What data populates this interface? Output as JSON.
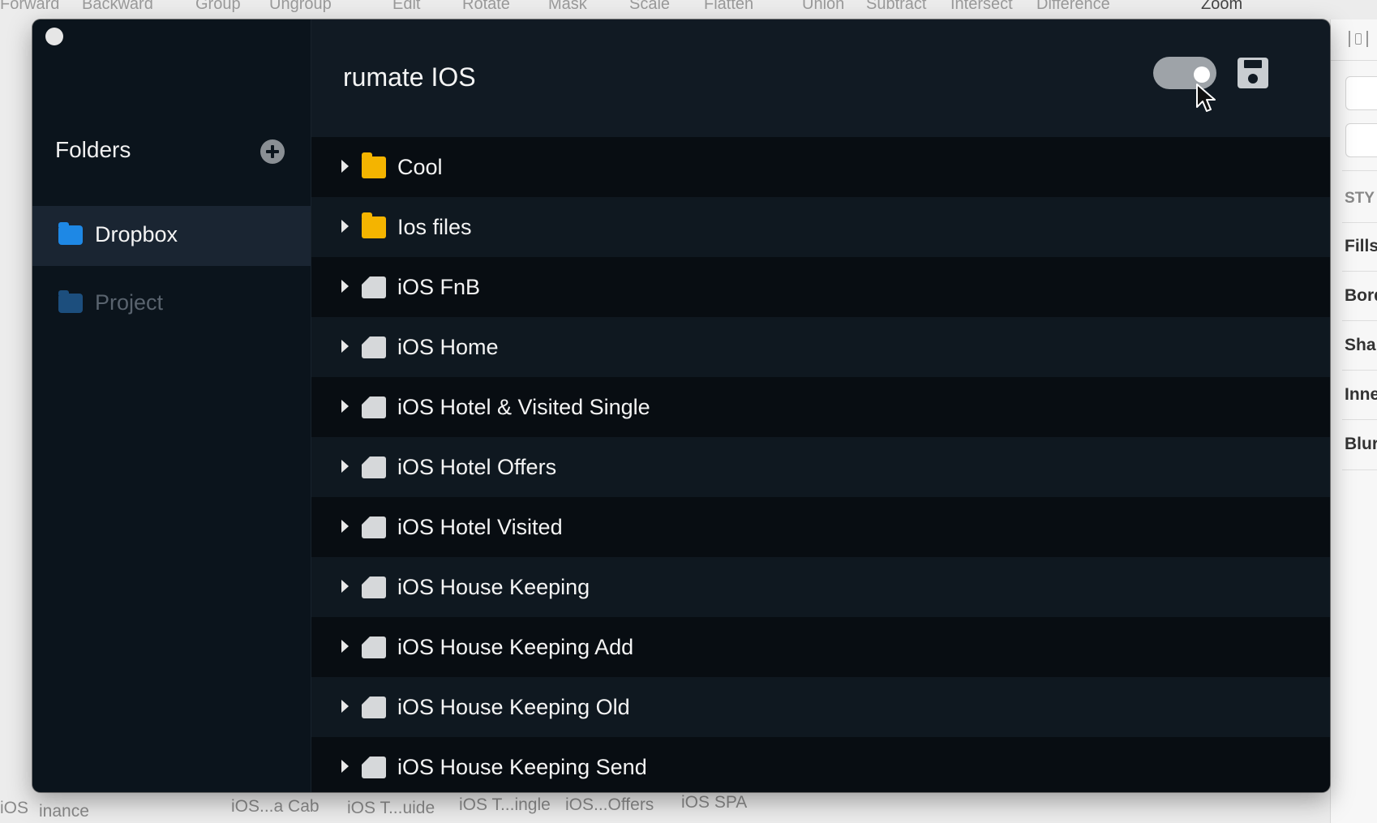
{
  "bg_toolbar": {
    "items": [
      "Forward",
      "Backward",
      "Group",
      "Ungroup",
      "Edit",
      "Rotate",
      "Mask",
      "Scale",
      "Flatten",
      "Union",
      "Subtract",
      "Intersect",
      "Difference",
      "Zoom"
    ]
  },
  "inspector": {
    "labels": [
      "STY",
      "Fills",
      "Bord",
      "Sha",
      "Inne",
      "Blur"
    ]
  },
  "bg_bottom": {
    "items": [
      "iOS",
      "inance",
      "iOS...a Cab",
      "iOS T...uide",
      "iOS T...ingle",
      "iOS...Offers",
      "iOS SPA"
    ]
  },
  "sidebar": {
    "title": "Folders",
    "items": [
      {
        "label": "Dropbox",
        "active": true,
        "color": "#1e88e5"
      },
      {
        "label": "Project",
        "active": false,
        "color": "#1c4e7d"
      }
    ]
  },
  "main": {
    "title": "rumate IOS",
    "toggle_on": true
  },
  "list": [
    {
      "label": "Cool",
      "icon": "yellow-folder-icon"
    },
    {
      "label": "Ios files",
      "icon": "yellow-folder-icon"
    },
    {
      "label": "iOS FnB",
      "icon": "grey-folder-icon"
    },
    {
      "label": "iOS Home",
      "icon": "grey-folder-icon"
    },
    {
      "label": "iOS Hotel & Visited Single",
      "icon": "grey-folder-icon"
    },
    {
      "label": "iOS Hotel Offers",
      "icon": "grey-folder-icon"
    },
    {
      "label": "iOS Hotel Visited",
      "icon": "grey-folder-icon"
    },
    {
      "label": "iOS House Keeping",
      "icon": "grey-folder-icon"
    },
    {
      "label": "iOS House Keeping Add",
      "icon": "grey-folder-icon"
    },
    {
      "label": "iOS House Keeping Old",
      "icon": "grey-folder-icon"
    },
    {
      "label": "iOS House Keeping Send",
      "icon": "grey-folder-icon"
    }
  ],
  "colors": {
    "window_bg": "#111a23",
    "sidebar_bg": "#0b141c",
    "active_item_bg": "#1a2532",
    "folder_yellow": "#f4b400",
    "folder_grey": "#d6d8da",
    "text": "#f4f4f4"
  }
}
